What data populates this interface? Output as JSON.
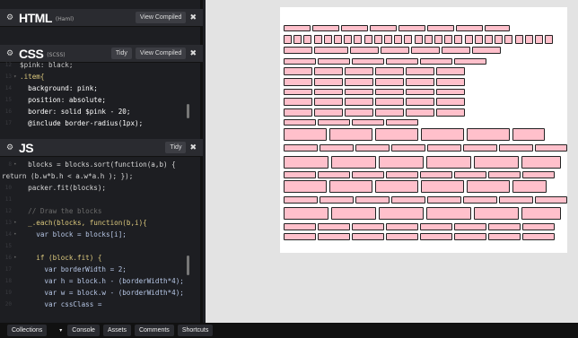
{
  "panes": {
    "html": {
      "title": "HTML",
      "subtitle": "(Haml)",
      "buttons": [
        "View Compiled"
      ],
      "close": "✖"
    },
    "css": {
      "title": "CSS",
      "subtitle": "(SCSS)",
      "buttons": [
        "Tidy",
        "View Compiled"
      ],
      "close": "✖"
    },
    "js": {
      "title": "JS",
      "subtitle": "",
      "buttons": [
        "Tidy"
      ],
      "close": "✖"
    }
  },
  "css_code": [
    "$pink: black;",
    ".item{",
    "  background: pink;",
    "  position: absolute;",
    "  border: solid $pink - 20;",
    "  @include border-radius(1px);"
  ],
  "js_code": [
    "  blocks = blocks.sort(function(a,b) {",
    "return (b.w*b.h < a.w*a.h ); });",
    "  packer.fit(blocks);",
    "",
    "  // Draw the blocks",
    "  _.each(blocks, function(b,i){",
    "    var block = blocks[i];",
    "",
    "    if (block.fit) {",
    "      var borderWidth = 2;",
    "      var h = block.h - (borderWidth*4);",
    "      var w = block.w - (borderWidth*4);",
    "      var cssClass ="
  ],
  "bottom_bar": {
    "tabs": [
      "Collections",
      "Console",
      "Assets",
      "Comments",
      "Shortcuts"
    ],
    "caret": "▾"
  },
  "colors": {
    "block_fill": "#ffc0cb",
    "block_border": "#222222",
    "preview_bg": "#e3e3e3",
    "editor_bg": "#1d1e22"
  }
}
